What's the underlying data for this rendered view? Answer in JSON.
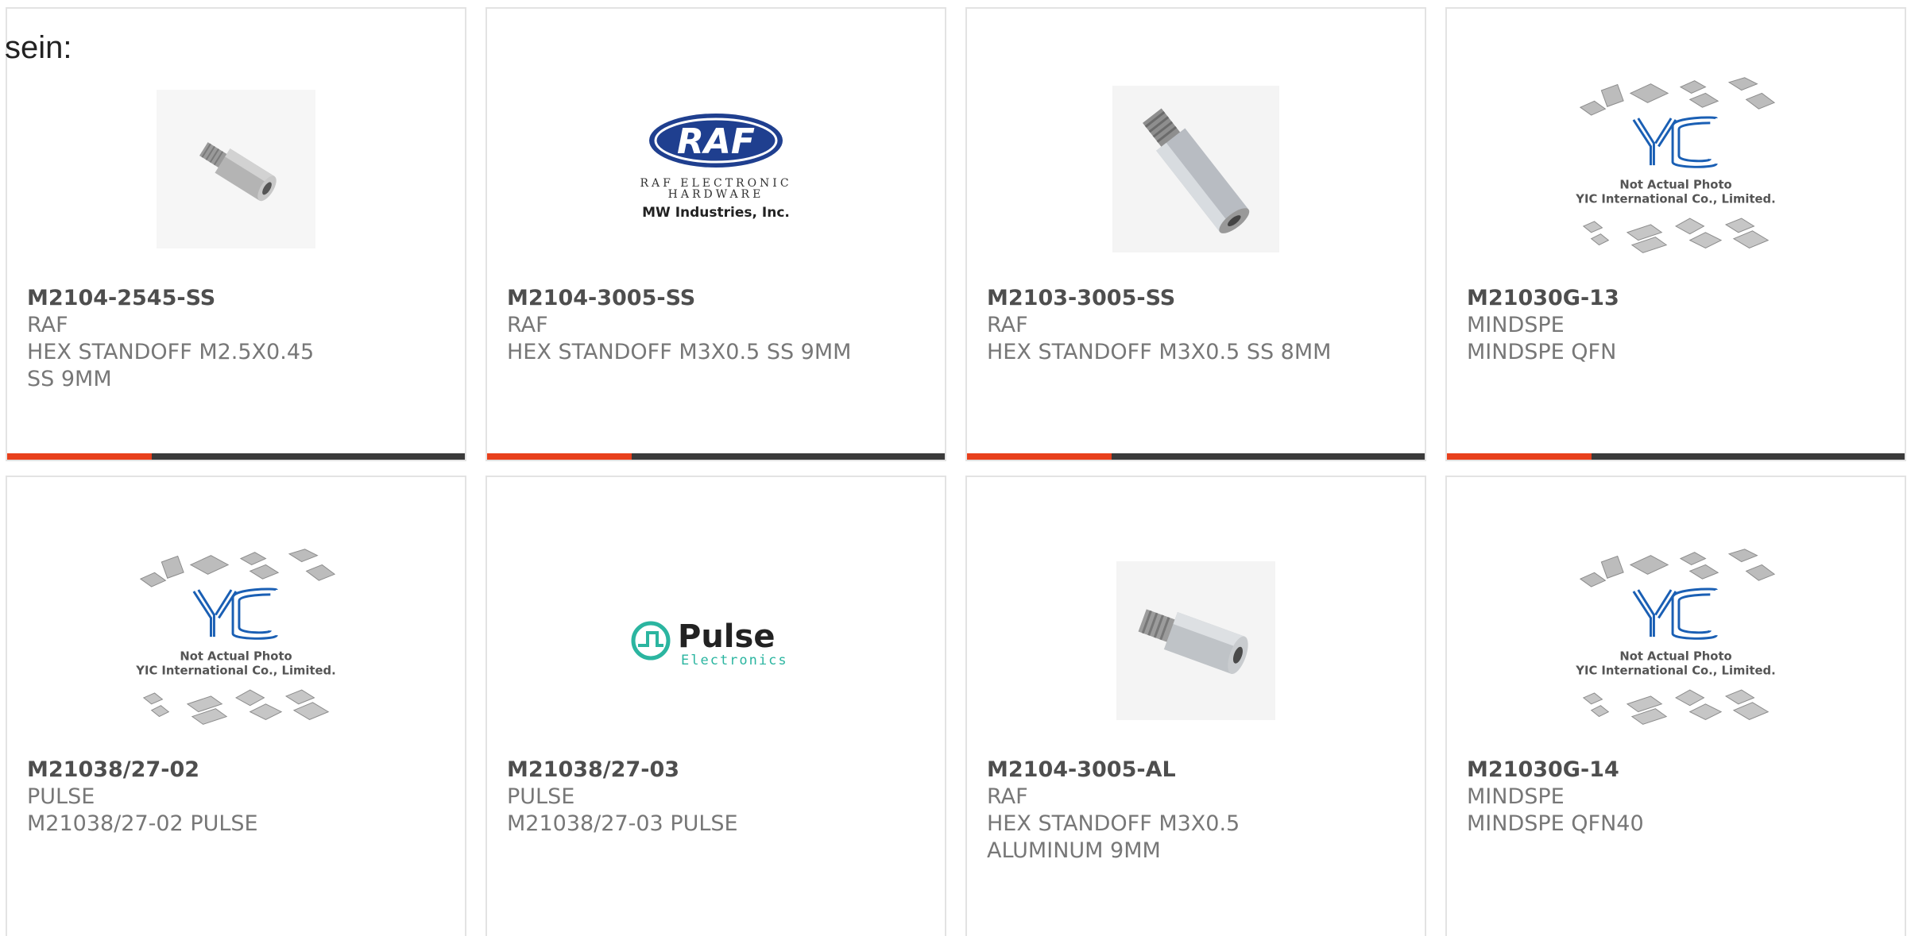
{
  "heading": "sein:",
  "products": [
    {
      "part_number": "M2104-2545-SS",
      "manufacturer": "RAF",
      "description": "HEX STANDOFF M2.5X0.45 SS 9MM",
      "image": "hex-standoff-photo"
    },
    {
      "part_number": "M2104-3005-SS",
      "manufacturer": "RAF",
      "description": "HEX STANDOFF M3X0.5 SS 9MM",
      "image": "raf-logo",
      "logo": {
        "brand": "RAF",
        "line1": "RAF ELECTRONIC",
        "line2": "HARDWARE",
        "line3": "MW Industries, Inc."
      }
    },
    {
      "part_number": "M2103-3005-SS",
      "manufacturer": "RAF",
      "description": "HEX STANDOFF M3X0.5 SS 8MM",
      "image": "hex-standoff-photo"
    },
    {
      "part_number": "M21030G-13",
      "manufacturer": "MINDSPE",
      "description": "MINDSPE QFN",
      "image": "yic-placeholder",
      "placeholder": {
        "brand": "YIC",
        "line1": "Not Actual Photo",
        "line2": "YIC International Co., Limited."
      }
    },
    {
      "part_number": "M21038/27-02",
      "manufacturer": "PULSE",
      "description": "M21038/27-02 PULSE",
      "image": "yic-placeholder",
      "placeholder": {
        "brand": "YIC",
        "line1": "Not Actual Photo",
        "line2": "YIC International Co., Limited."
      }
    },
    {
      "part_number": "M21038/27-03",
      "manufacturer": "PULSE",
      "description": "M21038/27-03 PULSE",
      "image": "pulse-logo",
      "logo": {
        "brand": "Pulse",
        "line1": "Electronics"
      }
    },
    {
      "part_number": "M2104-3005-AL",
      "manufacturer": "RAF",
      "description": "HEX STANDOFF M3X0.5 ALUMINUM 9MM",
      "image": "hex-standoff-photo"
    },
    {
      "part_number": "M21030G-14",
      "manufacturer": "MINDSPE",
      "description": "MINDSPE QFN40",
      "image": "yic-placeholder",
      "placeholder": {
        "brand": "YIC",
        "line1": "Not Actual Photo",
        "line2": "YIC International Co., Limited."
      }
    }
  ],
  "colors": {
    "accent": "#e8401c",
    "bar": "#3b3b3b",
    "border": "#e3e3e3",
    "yic_blue": "#1a5fb4",
    "raf_blue": "#1f3f8f",
    "pulse_teal": "#2bb5a0"
  }
}
